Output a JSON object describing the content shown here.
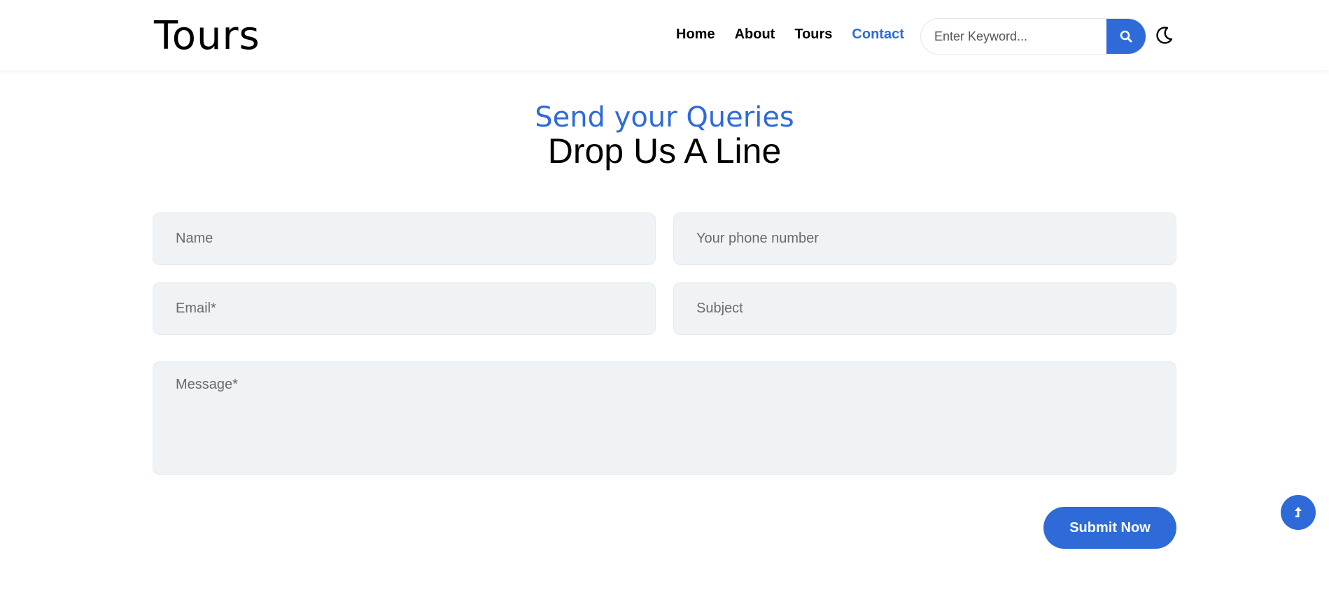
{
  "header": {
    "logo": "Tours",
    "nav": [
      {
        "label": "Home",
        "active": false
      },
      {
        "label": "About",
        "active": false
      },
      {
        "label": "Tours",
        "active": false
      },
      {
        "label": "Contact",
        "active": true
      }
    ],
    "search": {
      "placeholder": "Enter Keyword...",
      "button_icon": "search-icon"
    },
    "theme_toggle_icon": "moon-icon"
  },
  "section": {
    "subtitle": "Send your Queries",
    "title": "Drop Us A Line"
  },
  "form": {
    "name_placeholder": "Name",
    "phone_placeholder": "Your phone number",
    "email_placeholder": "Email*",
    "subject_placeholder": "Subject",
    "message_placeholder": "Message*",
    "submit_label": "Submit Now"
  },
  "scroll_top_icon": "arrow-up-icon",
  "colors": {
    "accent": "#2f6ad9",
    "field_bg": "#f0f3f6"
  }
}
